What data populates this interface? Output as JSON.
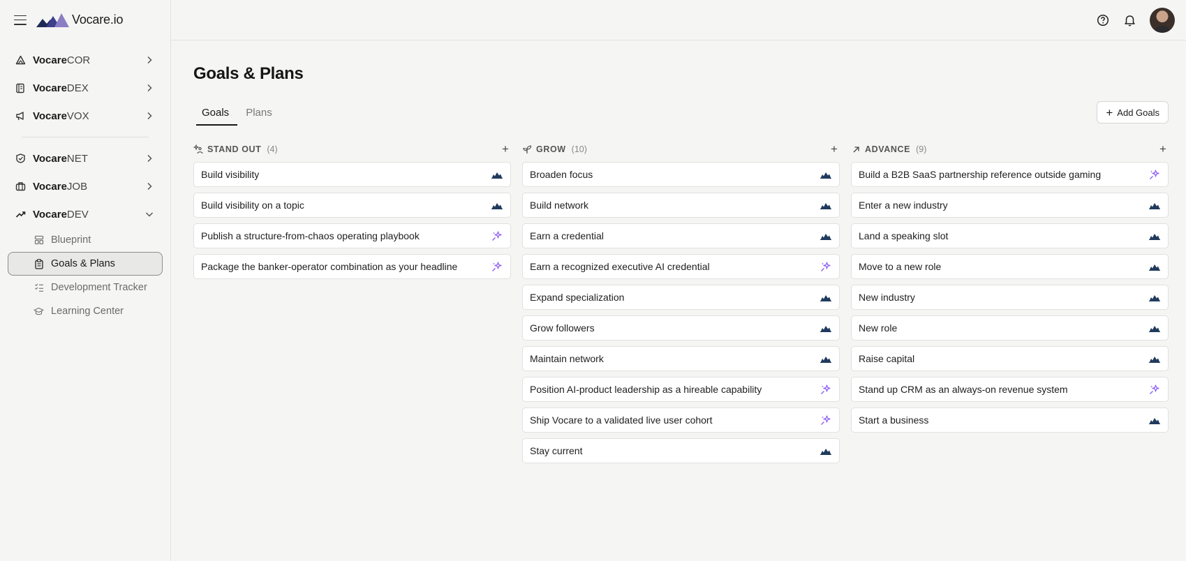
{
  "brand": {
    "name": "Vocare.io"
  },
  "sidebar": {
    "groups": [
      {
        "bold": "Vocare",
        "suffix": "COR",
        "icon": "triangle-icon"
      },
      {
        "bold": "Vocare",
        "suffix": "DEX",
        "icon": "book-icon"
      },
      {
        "bold": "Vocare",
        "suffix": "VOX",
        "icon": "megaphone-icon"
      },
      {
        "bold": "Vocare",
        "suffix": "NET",
        "icon": "network-icon"
      },
      {
        "bold": "Vocare",
        "suffix": "JOB",
        "icon": "briefcase-icon"
      },
      {
        "bold": "Vocare",
        "suffix": "DEV",
        "icon": "trending-up-icon"
      }
    ],
    "dev_items": [
      {
        "label": "Blueprint",
        "icon": "layout-icon"
      },
      {
        "label": "Goals & Plans",
        "icon": "clipboard-icon"
      },
      {
        "label": "Development Tracker",
        "icon": "checklist-icon"
      },
      {
        "label": "Learning Center",
        "icon": "graduation-cap-icon"
      }
    ]
  },
  "page": {
    "title": "Goals & Plans",
    "tabs": [
      "Goals",
      "Plans"
    ],
    "active_tab": "Goals",
    "add_button": "Add Goals"
  },
  "columns": [
    {
      "title": "STAND OUT",
      "count": "(4)",
      "icon": "sparkle-person-icon",
      "cards": [
        {
          "text": "Build visibility",
          "kind": "chart"
        },
        {
          "text": "Build visibility on a topic",
          "kind": "chart"
        },
        {
          "text": "Publish a structure-from-chaos operating playbook",
          "kind": "ai"
        },
        {
          "text": "Package the banker-operator combination as your headline",
          "kind": "ai"
        }
      ]
    },
    {
      "title": "GROW",
      "count": "(10)",
      "icon": "sprout-icon",
      "cards": [
        {
          "text": "Broaden focus",
          "kind": "chart"
        },
        {
          "text": "Build network",
          "kind": "chart"
        },
        {
          "text": "Earn a credential",
          "kind": "chart"
        },
        {
          "text": "Earn a recognized executive AI credential",
          "kind": "ai"
        },
        {
          "text": "Expand specialization",
          "kind": "chart"
        },
        {
          "text": "Grow followers",
          "kind": "chart"
        },
        {
          "text": "Maintain network",
          "kind": "chart"
        },
        {
          "text": "Position AI-product leadership as a hireable capability",
          "kind": "ai"
        },
        {
          "text": "Ship Vocare to a validated live user cohort",
          "kind": "ai"
        },
        {
          "text": "Stay current",
          "kind": "chart"
        }
      ]
    },
    {
      "title": "ADVANCE",
      "count": "(9)",
      "icon": "arrow-up-right-icon",
      "cards": [
        {
          "text": "Build a B2B SaaS partnership reference outside gaming",
          "kind": "ai"
        },
        {
          "text": "Enter a new industry",
          "kind": "chart"
        },
        {
          "text": "Land a speaking slot",
          "kind": "chart"
        },
        {
          "text": "Move to a new role",
          "kind": "chart"
        },
        {
          "text": "New industry",
          "kind": "chart"
        },
        {
          "text": "New role",
          "kind": "chart"
        },
        {
          "text": "Raise capital",
          "kind": "chart"
        },
        {
          "text": "Stand up CRM as an always-on revenue system",
          "kind": "ai"
        },
        {
          "text": "Start a business",
          "kind": "chart"
        }
      ]
    }
  ],
  "colors": {
    "chart_icon": "#1f3a5c",
    "ai_icon": "#8b5cf6",
    "logo_dark": "#1e2a55",
    "logo_light": "#8a7fc4"
  }
}
